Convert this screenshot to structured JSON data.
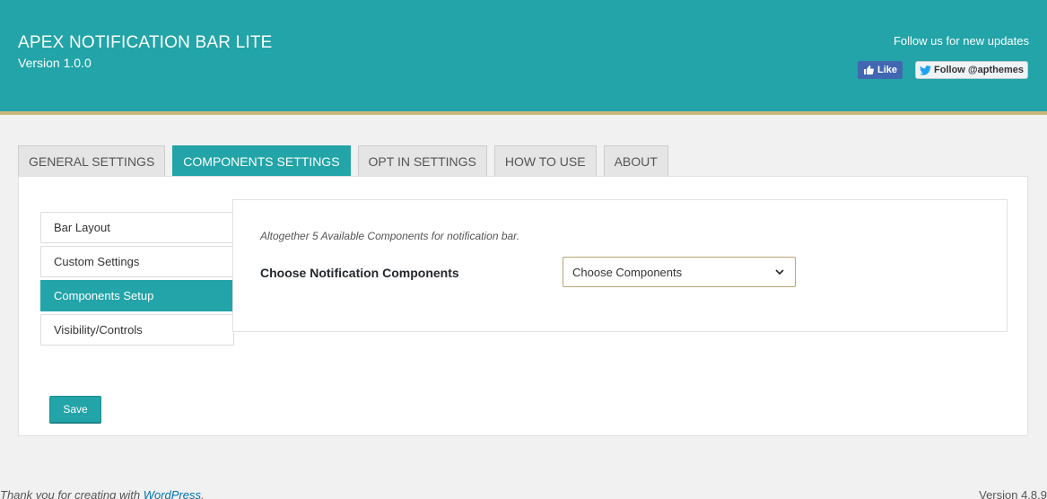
{
  "header": {
    "title": "APEX NOTIFICATION BAR LITE",
    "version": "Version 1.0.0",
    "follow_text": "Follow us for new updates",
    "like_label": "Like",
    "twitter_label": "Follow @apthemes"
  },
  "tabs": [
    {
      "label": "GENERAL SETTINGS",
      "active": false
    },
    {
      "label": "COMPONENTS SETTINGS",
      "active": true
    },
    {
      "label": "OPT IN SETTINGS",
      "active": false
    },
    {
      "label": "HOW TO USE",
      "active": false
    },
    {
      "label": "ABOUT",
      "active": false
    }
  ],
  "side_menu": [
    {
      "label": "Bar Layout",
      "active": false
    },
    {
      "label": "Custom Settings",
      "active": false
    },
    {
      "label": "Components Setup",
      "active": true
    },
    {
      "label": "Visibility/Controls",
      "active": false
    }
  ],
  "content": {
    "available_note": "Altogether 5 Available Components for notification bar.",
    "choose_label": "Choose Notification Components",
    "select_value": "Choose Components"
  },
  "save_label": "Save",
  "footer": {
    "thanks_prefix": "Thank you for creating with ",
    "wordpress_link": "WordPress",
    "thanks_suffix": ".",
    "wp_version": "Version 4.8.9"
  },
  "colors": {
    "accent": "#22a4a8",
    "header_border": "#c9b87a"
  }
}
